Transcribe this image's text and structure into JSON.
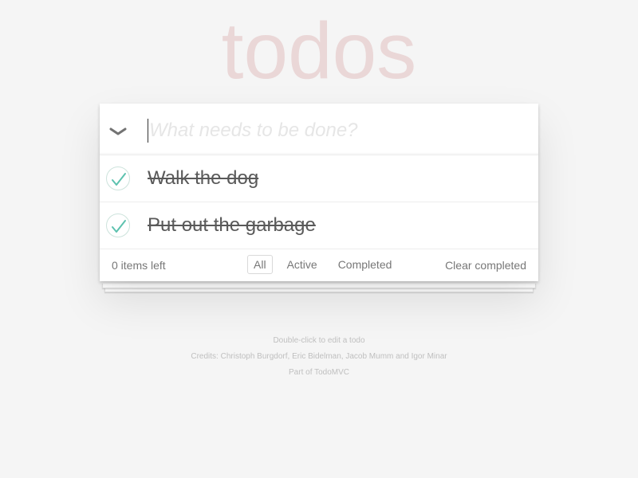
{
  "app": {
    "title": "todos"
  },
  "header": {
    "placeholder": "What needs to be done?",
    "toggle_all_icon": "chevron-down-icon"
  },
  "todos": [
    {
      "label": "Walk the dog",
      "completed": true
    },
    {
      "label": "Put out the garbage",
      "completed": true
    }
  ],
  "footer": {
    "count_text": "0 items left",
    "filters": [
      {
        "label": "All",
        "selected": true
      },
      {
        "label": "Active",
        "selected": false
      },
      {
        "label": "Completed",
        "selected": false
      }
    ],
    "clear_label": "Clear completed"
  },
  "info": {
    "edit_hint": "Double-click to edit a todo",
    "credits": "Credits: Christoph Burgdorf, Eric Bidelman, Jacob Mumm and Igor Minar",
    "part_of": "Part of TodoMVC"
  },
  "colors": {
    "title": "#ead7d7",
    "check": "#5dc2af",
    "check_border": "#cde3dc",
    "background": "#f5f5f5"
  }
}
